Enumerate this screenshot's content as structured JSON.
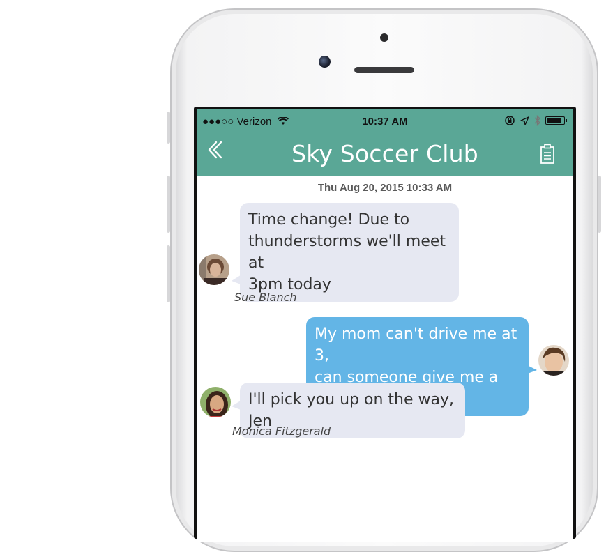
{
  "statusbar": {
    "carrier": "●●●○○ Verizon",
    "time": "10:37 AM"
  },
  "header": {
    "title": "Sky Soccer Club"
  },
  "conversation": {
    "date": "Thu Aug 20, 2015 10:33 AM",
    "messages": [
      {
        "sender": "Sue Blanch",
        "lines": [
          "Time change! Due to",
          "thunderstorms we'll meet at",
          "3pm today"
        ],
        "direction": "incoming"
      },
      {
        "sender": "",
        "lines": [
          "My mom can't drive me at 3,",
          "can someone give me a ride?"
        ],
        "direction": "outgoing"
      },
      {
        "sender": "Monica Fitzgerald",
        "lines": [
          "I'll pick you up on the way, Jen"
        ],
        "direction": "incoming"
      }
    ]
  },
  "colors": {
    "navbar": "#5aa796",
    "incoming_bubble": "#e6e8f2",
    "outgoing_bubble": "#63b5e6"
  },
  "icons": {
    "back": "double-chevron-left-icon",
    "notes": "document-icon",
    "wifi": "wifi-icon",
    "lock": "orientation-lock-icon",
    "location": "location-arrow-icon",
    "bluetooth": "bluetooth-icon",
    "battery": "battery-icon"
  }
}
